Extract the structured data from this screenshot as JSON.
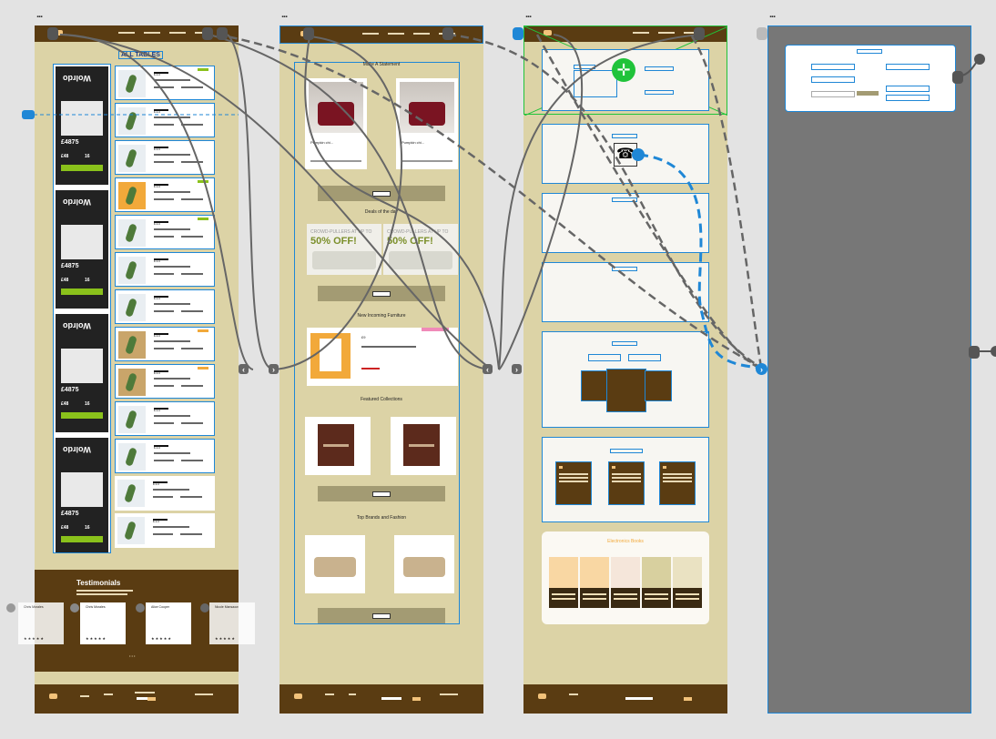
{
  "canvas": {
    "background": "#e3e3e3",
    "accent": "#1f87d6",
    "artboard_color": "#dcd3a6",
    "brown": "#5a3c12",
    "green_handle": "#20c33a",
    "artboard_menu": "...",
    "nav_arrow_left": "‹",
    "nav_arrow_right": "›"
  },
  "artboard1": {
    "heading": "ALL TABLES",
    "promo_brand": "Wolrdo",
    "promo_price": "£4875",
    "promo_sub": "£48",
    "promo_qty": "16",
    "list_prices": [
      "£13",
      "£13",
      "£13",
      "£13",
      "£13",
      "£13",
      "£13",
      "£13",
      "£13",
      "£13",
      "£13",
      "£13",
      "£13"
    ],
    "testimonials_title": "Testimonials",
    "testimonials": [
      {
        "name": "Chris Morales",
        "stars": "★★★★★"
      },
      {
        "name": "Chris Morales",
        "stars": "★★★★★"
      },
      {
        "name": "Alice Cooper",
        "stars": "★★★★★"
      },
      {
        "name": "Nicole Mansaow",
        "stars": "★★★★★"
      }
    ]
  },
  "artboard2": {
    "section1": "Make A Statement",
    "product_name": "Pumpkin chi...",
    "section2": "Deals of the day",
    "banner_small": "CROWD-PULLERS AT UP TO",
    "banner_big": "50% OFF!",
    "section3": "New Incoming Furniture",
    "incoming_price": "£9",
    "section4": "Featured Collections",
    "section5": "Top Brands and Fashion"
  },
  "artboard3": {
    "phone_icon": "☎",
    "palette_title": "Electronics Books",
    "palette_colors": [
      "#f9d7a3",
      "#f9d7a3",
      "#f5e6da",
      "#d8d09f",
      "#eae2c2"
    ]
  },
  "artboard4": {
    "background": "#777777"
  }
}
